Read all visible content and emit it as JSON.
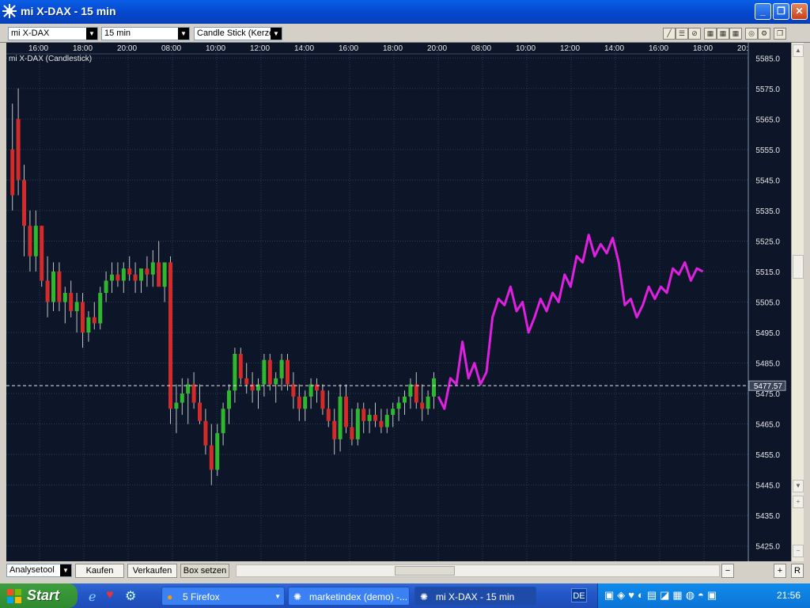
{
  "window": {
    "title": "mi X-DAX - 15 min"
  },
  "toolbar": {
    "instrument": "mi X-DAX",
    "interval": "15 min",
    "chart_type": "Candle Stick (Kerze"
  },
  "chart": {
    "label": "mi X-DAX (Candlestick)",
    "time_labels": [
      "16:00",
      "18:00",
      "20:00",
      "08:00",
      "10:00",
      "12:00",
      "14:00",
      "16:00",
      "18:00",
      "20:00",
      "08:00",
      "10:00",
      "12:00",
      "14:00",
      "16:00",
      "18:00",
      "20:"
    ],
    "price_labels": [
      "5585.0",
      "5575.0",
      "5565.0",
      "5555.0",
      "5545.0",
      "5535.0",
      "5525.0",
      "5515.0",
      "5505.0",
      "5495.0",
      "5485.0",
      "5475.0",
      "5465.0",
      "5455.0",
      "5445.0",
      "5435.0",
      "5425.0"
    ],
    "current_price": "5477.57",
    "colors": {
      "background": "#0d1628",
      "up": "#2fb82f",
      "down": "#d42a2a",
      "forecast": "#e020e0"
    }
  },
  "chart_data": {
    "type": "candlestick",
    "ylim": [
      5420,
      5590
    ],
    "candles": [
      [
        5555,
        5570,
        5535,
        5540
      ],
      [
        5565,
        5575,
        5540,
        5545
      ],
      [
        5545,
        5550,
        5520,
        5530
      ],
      [
        5530,
        5535,
        5515,
        5520
      ],
      [
        5520,
        5535,
        5515,
        5530
      ],
      [
        5530,
        5530,
        5510,
        5512
      ],
      [
        5512,
        5520,
        5500,
        5505
      ],
      [
        5505,
        5518,
        5502,
        5515
      ],
      [
        5515,
        5518,
        5502,
        5505
      ],
      [
        5505,
        5510,
        5498,
        5508
      ],
      [
        5508,
        5512,
        5500,
        5502
      ],
      [
        5502,
        5508,
        5495,
        5505
      ],
      [
        5505,
        5508,
        5490,
        5495
      ],
      [
        5495,
        5502,
        5492,
        5500
      ],
      [
        5500,
        5505,
        5496,
        5498
      ],
      [
        5498,
        5510,
        5496,
        5508
      ],
      [
        5508,
        5515,
        5505,
        5512
      ],
      [
        5512,
        5518,
        5508,
        5514
      ],
      [
        5514,
        5518,
        5510,
        5512
      ],
      [
        5512,
        5518,
        5508,
        5516
      ],
      [
        5516,
        5520,
        5512,
        5514
      ],
      [
        5514,
        5518,
        5508,
        5512
      ],
      [
        5512,
        5515,
        5508,
        5516
      ],
      [
        5516,
        5520,
        5510,
        5514
      ],
      [
        5514,
        5522,
        5510,
        5518
      ],
      [
        5518,
        5525,
        5512,
        5510
      ],
      [
        5510,
        5515,
        5505,
        5518
      ],
      [
        5518,
        5520,
        5465,
        5470
      ],
      [
        5470,
        5478,
        5462,
        5472
      ],
      [
        5472,
        5480,
        5468,
        5475
      ],
      [
        5475,
        5480,
        5465,
        5478
      ],
      [
        5478,
        5482,
        5470,
        5472
      ],
      [
        5472,
        5478,
        5465,
        5466
      ],
      [
        5466,
        5470,
        5455,
        5458
      ],
      [
        5458,
        5465,
        5445,
        5450
      ],
      [
        5450,
        5465,
        5448,
        5462
      ],
      [
        5462,
        5472,
        5458,
        5470
      ],
      [
        5470,
        5478,
        5465,
        5476
      ],
      [
        5476,
        5490,
        5472,
        5488
      ],
      [
        5488,
        5490,
        5478,
        5480
      ],
      [
        5480,
        5485,
        5475,
        5478
      ],
      [
        5478,
        5482,
        5472,
        5476
      ],
      [
        5476,
        5480,
        5470,
        5478
      ],
      [
        5478,
        5488,
        5474,
        5486
      ],
      [
        5486,
        5488,
        5476,
        5478
      ],
      [
        5478,
        5482,
        5472,
        5480
      ],
      [
        5480,
        5488,
        5476,
        5486
      ],
      [
        5486,
        5488,
        5476,
        5478
      ],
      [
        5478,
        5482,
        5470,
        5474
      ],
      [
        5474,
        5478,
        5466,
        5470
      ],
      [
        5470,
        5476,
        5466,
        5474
      ],
      [
        5474,
        5480,
        5470,
        5478
      ],
      [
        5478,
        5480,
        5472,
        5476
      ],
      [
        5476,
        5478,
        5468,
        5470
      ],
      [
        5470,
        5476,
        5464,
        5466
      ],
      [
        5466,
        5470,
        5455,
        5460
      ],
      [
        5460,
        5478,
        5456,
        5474
      ],
      [
        5474,
        5478,
        5462,
        5464
      ],
      [
        5464,
        5470,
        5458,
        5460
      ],
      [
        5460,
        5472,
        5458,
        5470
      ],
      [
        5470,
        5472,
        5462,
        5466
      ],
      [
        5466,
        5470,
        5462,
        5468
      ],
      [
        5468,
        5472,
        5464,
        5466
      ],
      [
        5466,
        5470,
        5462,
        5464
      ],
      [
        5464,
        5470,
        5462,
        5468
      ],
      [
        5468,
        5472,
        5464,
        5470
      ],
      [
        5470,
        5474,
        5466,
        5472
      ],
      [
        5472,
        5476,
        5468,
        5474
      ],
      [
        5474,
        5480,
        5470,
        5478
      ],
      [
        5478,
        5482,
        5470,
        5472
      ],
      [
        5472,
        5478,
        5466,
        5470
      ],
      [
        5470,
        5476,
        5468,
        5474
      ],
      [
        5474,
        5482,
        5470,
        5480
      ]
    ],
    "forecast": [
      5474,
      5470,
      5480,
      5478,
      5492,
      5480,
      5485,
      5478,
      5482,
      5500,
      5506,
      5504,
      5510,
      5502,
      5505,
      5495,
      5500,
      5506,
      5502,
      5508,
      5505,
      5514,
      5510,
      5520,
      5518,
      5527,
      5520,
      5524,
      5521,
      5526,
      5518,
      5504,
      5506,
      5500,
      5504,
      5510,
      5506,
      5510,
      5508,
      5516,
      5514,
      5518,
      5512,
      5516,
      5515
    ]
  },
  "bottombar": {
    "analysis_tool": "Analysetool",
    "buy": "Kaufen",
    "sell": "Verkaufen",
    "box": "Box setzen",
    "reset": "R"
  },
  "taskbar": {
    "start": "Start",
    "tasks": [
      "5 Firefox",
      "marketindex (demo) -...",
      "mi X-DAX - 15 min"
    ],
    "lang": "DE",
    "clock": "21:56"
  }
}
